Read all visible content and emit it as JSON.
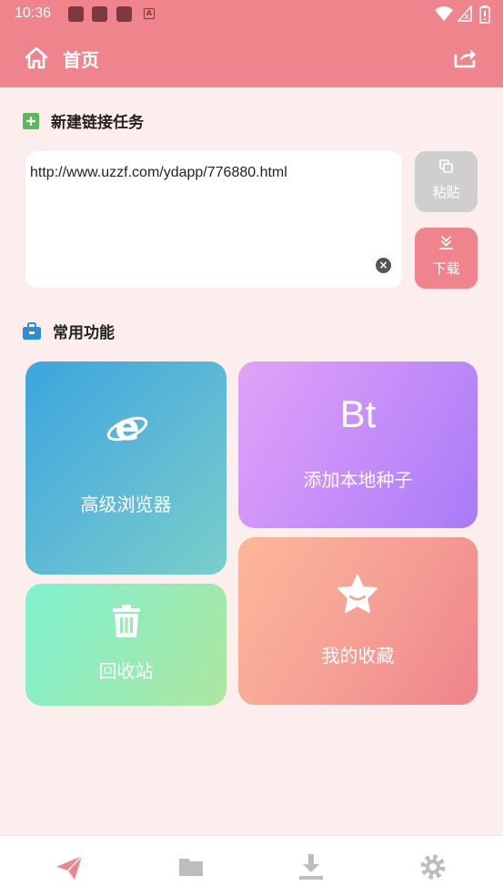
{
  "status_bar": {
    "time": "10:36",
    "notif_badge": "A"
  },
  "appbar": {
    "title": "首页",
    "home_icon": "home-icon",
    "share_icon": "share-icon"
  },
  "new_task": {
    "heading": "新建链接任务",
    "icon": "plus-square-icon",
    "url_value": "http://www.uzzf.com/ydapp/776880.html",
    "paste_label": "粘贴",
    "download_label": "下载"
  },
  "common": {
    "heading": "常用功能",
    "icon": "toolbox-icon",
    "cards": {
      "browser": "高级浏览器",
      "bt_glyph": "Bt",
      "bt": "添加本地种子",
      "recycle": "回收站",
      "favorites": "我的收藏"
    }
  },
  "bottom_nav": [
    "send-icon",
    "folder-icon",
    "download-tray-icon",
    "gear-icon"
  ],
  "colors": {
    "accent": "#f0848c",
    "background": "#fdeeee",
    "paste_disabled": "#cfcfcf"
  }
}
